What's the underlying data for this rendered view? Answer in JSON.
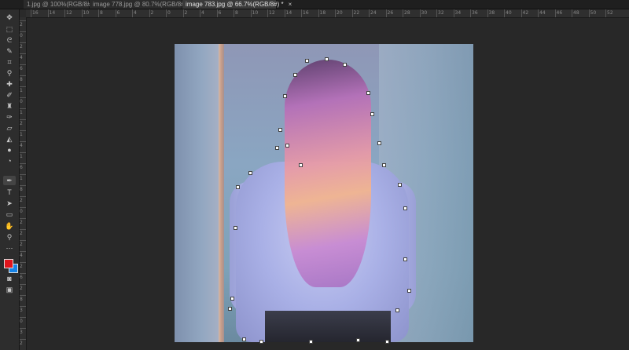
{
  "tabs": [
    {
      "label": "1.jpg @ 100%(RGB/8#)",
      "close": "×",
      "active": false
    },
    {
      "label": "image 778.jpg @ 80.7%(RGB/8#) *",
      "close": "×",
      "active": false
    },
    {
      "label": "image 783.jpg @ 66.7%(RGB/8#) *",
      "close": "×",
      "active": true
    }
  ],
  "ruler_top": [
    "16",
    "14",
    "12",
    "10",
    "8",
    "6",
    "4",
    "2",
    "0",
    "2",
    "4",
    "6",
    "8",
    "10",
    "12",
    "14",
    "16",
    "18",
    "20",
    "22",
    "24",
    "26",
    "28",
    "30",
    "32",
    "34",
    "36",
    "38",
    "40",
    "42",
    "44",
    "46",
    "48",
    "50",
    "52"
  ],
  "ruler_left": [
    "2",
    "0",
    "2",
    "4",
    "6",
    "8",
    "1",
    "0",
    "1",
    "2",
    "1",
    "4",
    "1",
    "6",
    "1",
    "8",
    "2",
    "0",
    "2",
    "2",
    "2",
    "4",
    "2",
    "6",
    "2",
    "8",
    "3",
    "0",
    "3",
    "2"
  ],
  "tools": [
    "move-icon",
    "marquee-icon",
    "lasso-icon",
    "quick-select-icon",
    "crop-icon",
    "eyedropper-icon",
    "healing-icon",
    "brush-icon",
    "stamp-icon",
    "history-brush-icon",
    "eraser-icon",
    "paint-bucket-icon",
    "blur-icon",
    "dodge-icon",
    "pen-icon",
    "type-icon",
    "path-select-icon",
    "rectangle-icon",
    "hand-icon",
    "zoom-icon",
    "more-icon"
  ],
  "colors": {
    "foreground": "#e0141c",
    "background": "#1683e6"
  }
}
